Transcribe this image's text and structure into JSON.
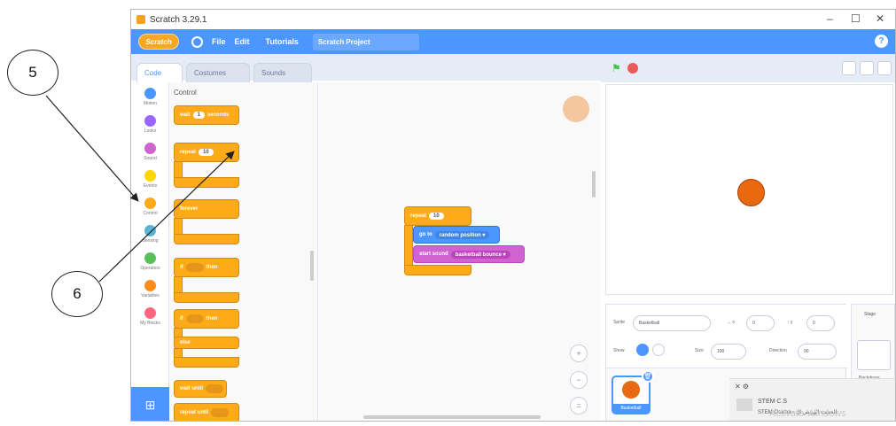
{
  "window": {
    "title": "Scratch 3.29.1",
    "controls": {
      "minimize": "–",
      "maximize": "☐",
      "close": "✕"
    }
  },
  "menubar": {
    "logo": "Scratch",
    "items": [
      "File",
      "Edit"
    ],
    "tutorials": "Tutorials",
    "project_title": "Scratch Project",
    "help": "?"
  },
  "tabs": [
    {
      "label": "Code",
      "icon": "code-icon"
    },
    {
      "label": "Costumes",
      "icon": "brush-icon"
    },
    {
      "label": "Sounds",
      "icon": "speaker-icon"
    }
  ],
  "categories": [
    {
      "label": "Motion",
      "color": "#4c97ff"
    },
    {
      "label": "Looks",
      "color": "#9966ff"
    },
    {
      "label": "Sound",
      "color": "#cf63cf"
    },
    {
      "label": "Events",
      "color": "#ffd500"
    },
    {
      "label": "Control",
      "color": "#ffab19"
    },
    {
      "label": "Sensing",
      "color": "#5cb1d6"
    },
    {
      "label": "Operators",
      "color": "#59c059"
    },
    {
      "label": "Variables",
      "color": "#ff8c1a"
    },
    {
      "label": "My Blocks",
      "color": "#ff6680"
    }
  ],
  "palette": {
    "title": "Control",
    "blocks": {
      "wait_label": "wait",
      "wait_value": "1",
      "wait_unit": "seconds",
      "repeat_label": "repeat",
      "repeat_value": "10",
      "forever_label": "forever",
      "if_label": "if",
      "then_label": "then",
      "if2_label": "if",
      "then2_label": "then",
      "else_label": "else",
      "wait_until_label": "wait until",
      "repeat_until_label": "repeat until"
    }
  },
  "script": {
    "repeat_label": "repeat",
    "repeat_value": "10",
    "goto_label": "go to",
    "goto_value": "random position ▾",
    "sound_label": "start sound",
    "sound_value": "basketball bounce ▾"
  },
  "zoom": {
    "zoom_in": "+",
    "zoom_out": "−",
    "reset": "="
  },
  "sprite_info": {
    "sprite_label": "Sprite",
    "sprite_name": "Basketball",
    "x_label": "↔ x",
    "x_value": "0",
    "y_label": "↕ y",
    "y_value": "0",
    "show_label": "Show",
    "size_label": "Size",
    "size_value": "100",
    "direction_label": "Direction",
    "direction_value": "90"
  },
  "sprite_tile": {
    "label": "Basketball"
  },
  "stage_pane": {
    "label": "Stage",
    "backdrops_label": "Backdrops"
  },
  "notification": {
    "line1": "STEM C.S",
    "line2": "STEM Osama - الحديث الهويس ال"
  },
  "watermark": "Activate Windows",
  "annotations": {
    "callout_5": "5",
    "callout_6": "6"
  }
}
